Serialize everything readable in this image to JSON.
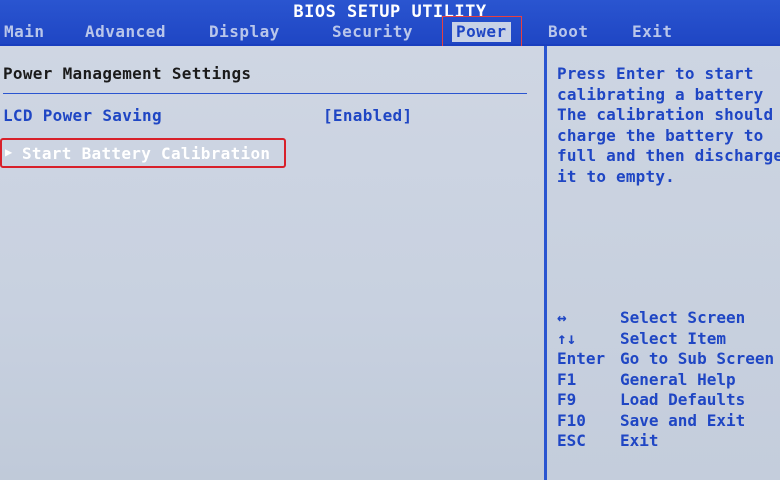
{
  "header": {
    "title": "BIOS SETUP UTILITY",
    "tabs": [
      {
        "label": "Main"
      },
      {
        "label": "Advanced"
      },
      {
        "label": "Display"
      },
      {
        "label": "Security"
      },
      {
        "label": "Power"
      },
      {
        "label": "Boot"
      },
      {
        "label": "Exit"
      }
    ],
    "active_tab": "Power"
  },
  "main": {
    "section_title": "Power Management Settings",
    "lcd_power_saving": {
      "label": "LCD Power Saving",
      "value": "[Enabled]"
    },
    "start_battery_calibration": {
      "arrow": "▶",
      "label": "Start Battery Calibration"
    }
  },
  "help": {
    "lines": [
      "Press Enter to start",
      "calibrating a battery",
      "The calibration should",
      "charge the battery to",
      "full and then discharge",
      "it to empty."
    ],
    "keys": [
      {
        "key": "↔",
        "desc": "Select Screen"
      },
      {
        "key": "↑↓",
        "desc": "Select Item"
      },
      {
        "key": "Enter",
        "desc": "Go to Sub Screen"
      },
      {
        "key": "F1",
        "desc": "General Help"
      },
      {
        "key": "F9",
        "desc": "Load Defaults"
      },
      {
        "key": "F10",
        "desc": "Save and Exit"
      },
      {
        "key": "ESC",
        "desc": "Exit"
      }
    ]
  },
  "colors": {
    "bios_blue": "#1f46c4",
    "panel_gray": "#c8d1e0",
    "highlight_red": "#d8202a",
    "text_white": "#ffffff"
  }
}
